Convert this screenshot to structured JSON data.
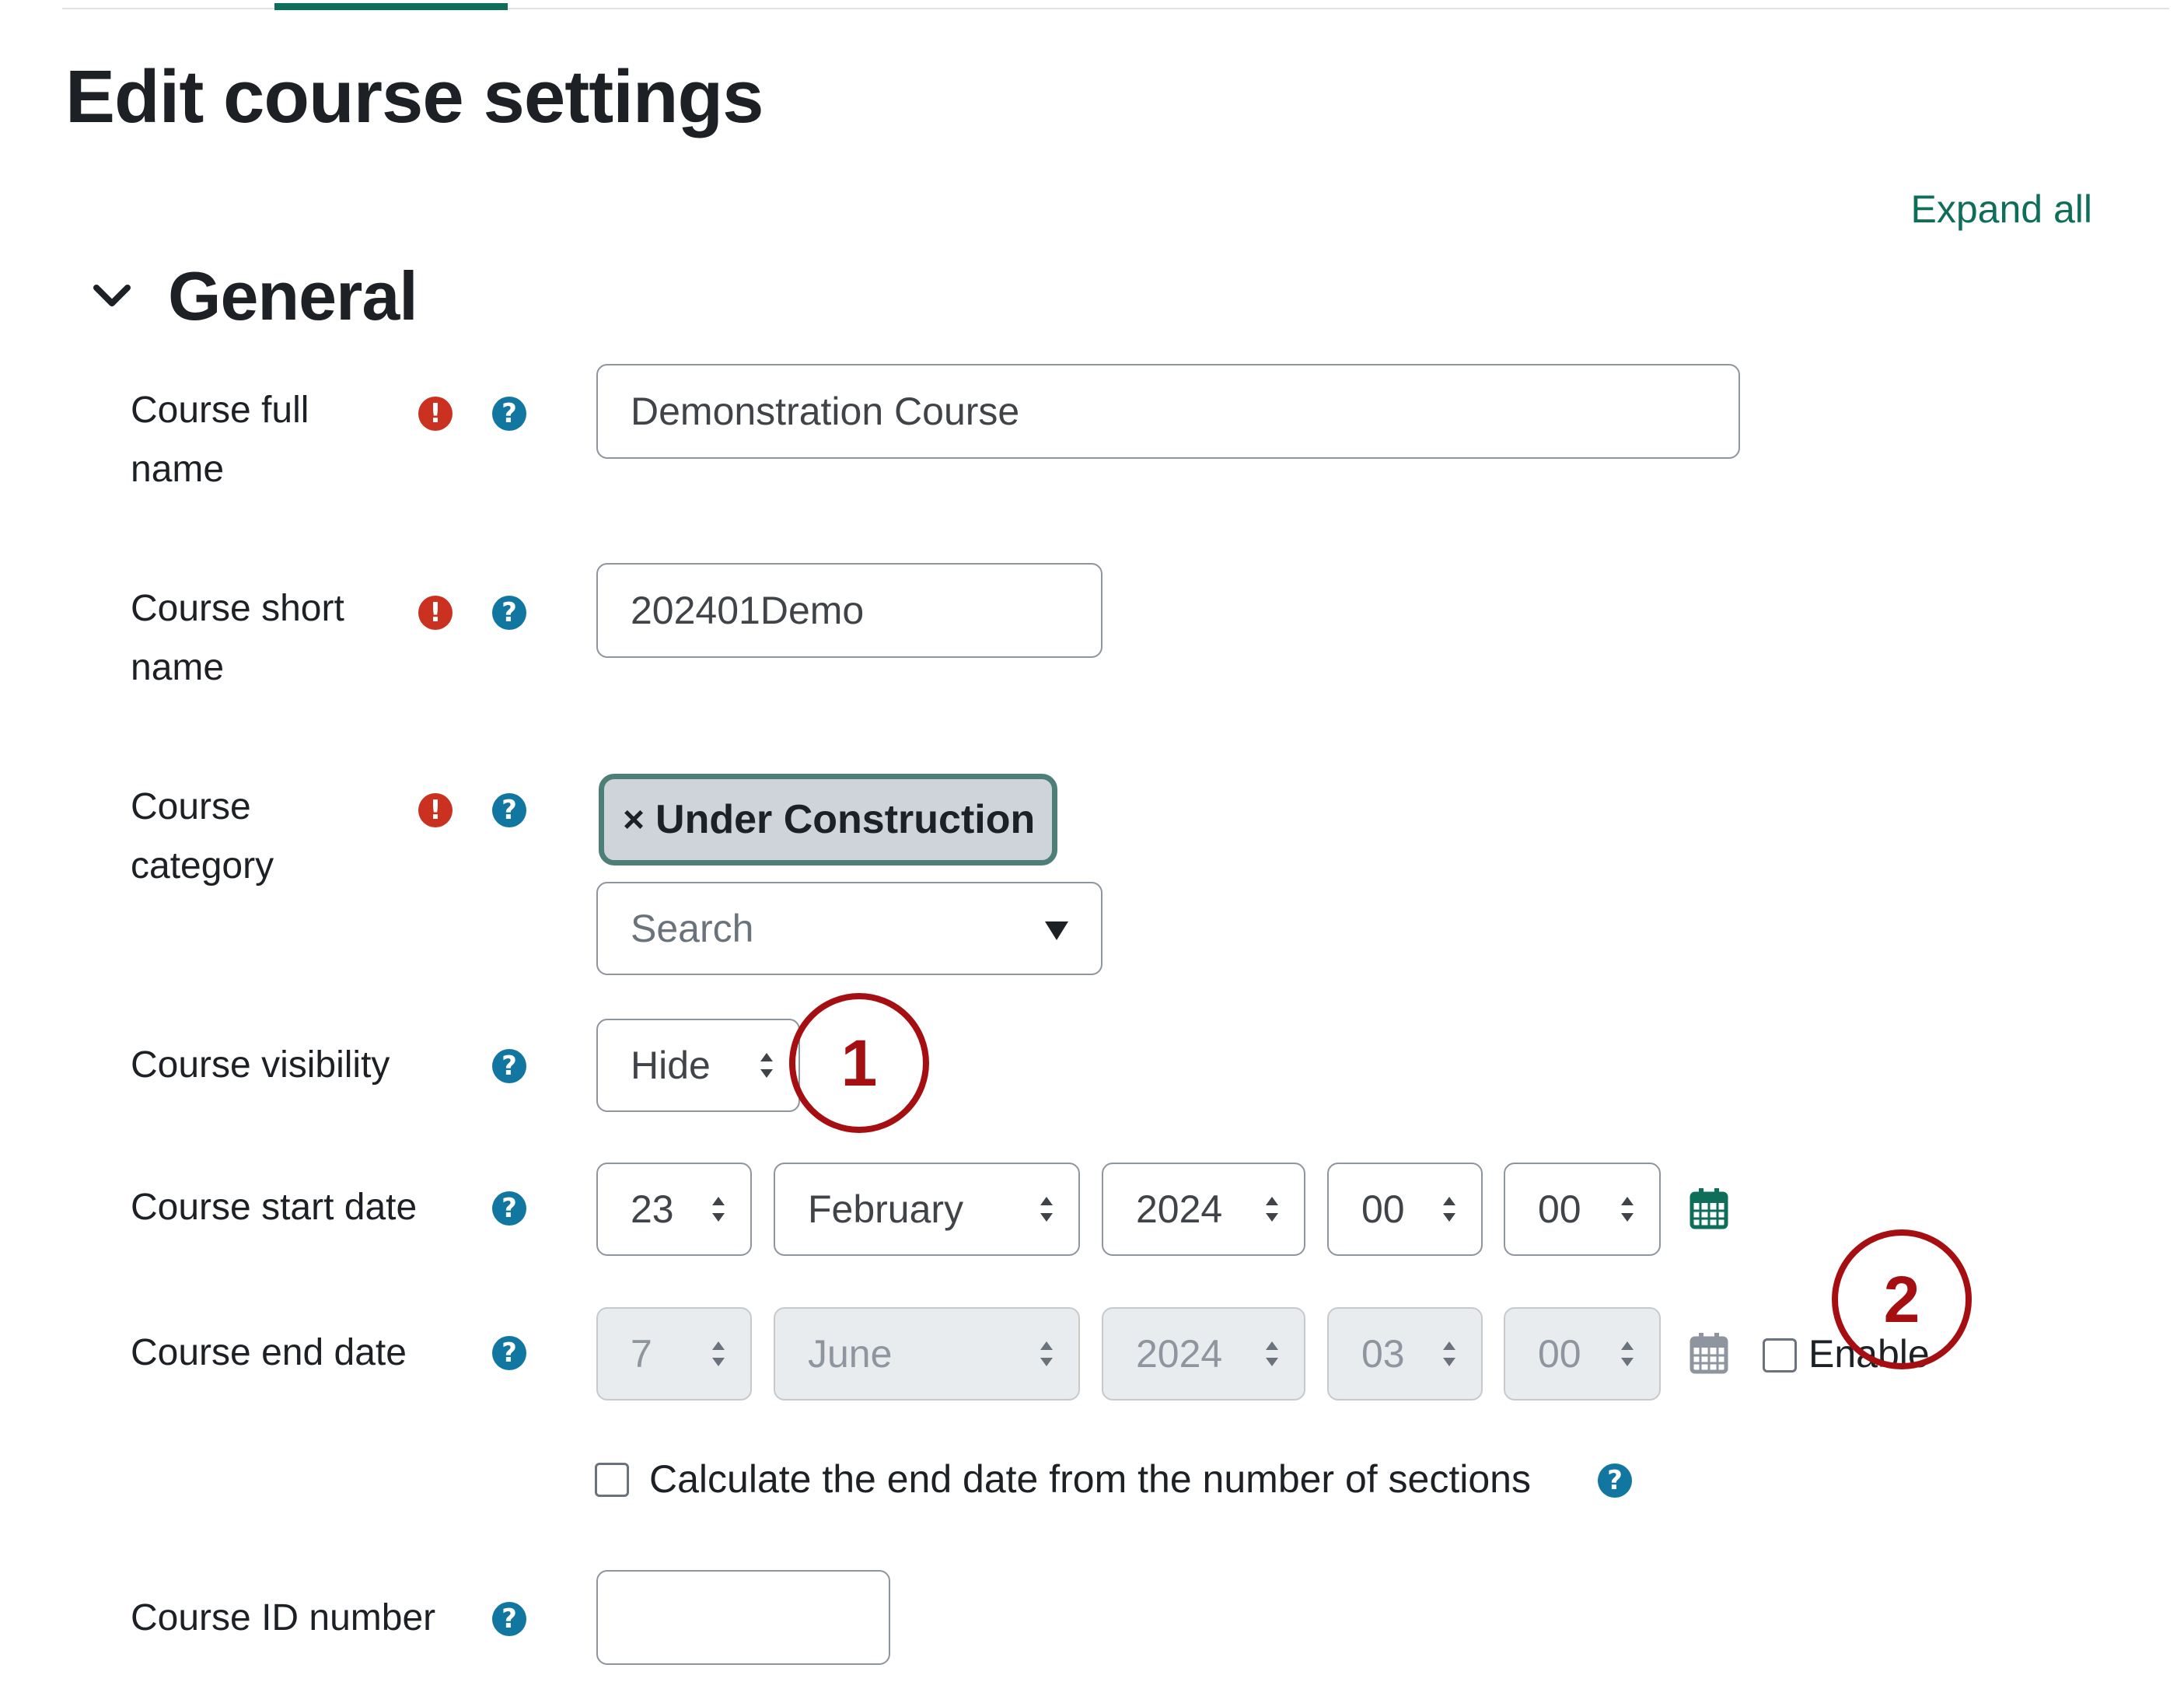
{
  "page": {
    "title": "Edit course settings",
    "expand_all": "Expand all"
  },
  "section": {
    "title": "General"
  },
  "fields": {
    "fullname": {
      "label_l1": "Course full",
      "label_l2": "name",
      "value": "Demonstration Course"
    },
    "shortname": {
      "label_l1": "Course short",
      "label_l2": "name",
      "value": "202401Demo"
    },
    "category": {
      "label_l1": "Course",
      "label_l2": "category",
      "tag_x": "×",
      "tag": "Under Construction",
      "search_placeholder": "Search"
    },
    "visibility": {
      "label": "Course visibility",
      "value": "Hide"
    },
    "startdate": {
      "label": "Course start date",
      "day": "23",
      "month": "February",
      "year": "2024",
      "hour": "00",
      "minute": "00"
    },
    "enddate": {
      "label": "Course end date",
      "day": "7",
      "month": "June",
      "year": "2024",
      "hour": "03",
      "minute": "00",
      "enable_label": "Enable"
    },
    "calc_end": {
      "label": "Calculate the end date from the number of sections"
    },
    "idnumber": {
      "label": "Course ID number",
      "value": ""
    }
  },
  "callouts": [
    "1",
    "2"
  ],
  "icons": {
    "required": "exclamation-icon",
    "help": "question-icon",
    "calendar": "calendar-icon",
    "collapse": "chevron-down-icon"
  },
  "colors": {
    "accent": "#0f6e59",
    "required": "#ca3120",
    "help": "#1177a0",
    "callout": "#a60f12"
  }
}
